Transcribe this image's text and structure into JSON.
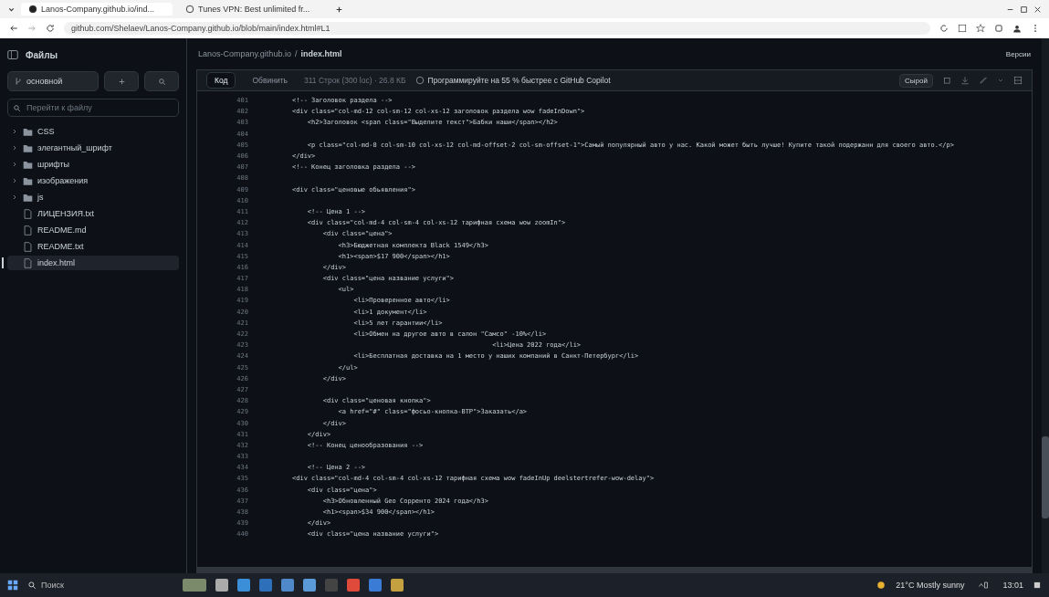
{
  "browser": {
    "tabs": [
      {
        "title": "Lanos-Company.github.io/ind...",
        "selected": true
      },
      {
        "title": "Tunes VPN: Best unlimited fr...",
        "selected": false
      }
    ],
    "address": "github.com/Shelaev/Lanos-Company.github.io/blob/main/index.html#L1"
  },
  "sidebar": {
    "title": "Файлы",
    "branch": "основной",
    "search": {
      "placeholder": "Перейти к файлу"
    },
    "items": [
      {
        "kind": "folder",
        "name": "CSS",
        "selected": false
      },
      {
        "kind": "folder",
        "name": "элегантный_шрифт",
        "selected": false
      },
      {
        "kind": "folder",
        "name": "шрифты",
        "selected": false
      },
      {
        "kind": "folder",
        "name": "изображения",
        "selected": false
      },
      {
        "kind": "folder",
        "name": "js",
        "selected": false
      },
      {
        "kind": "file",
        "name": "ЛИЦЕНЗИЯ.txt",
        "selected": false
      },
      {
        "kind": "file",
        "name": "README.md",
        "selected": false
      },
      {
        "kind": "file",
        "name": "README.txt",
        "selected": false
      },
      {
        "kind": "file",
        "name": "index.html",
        "selected": true
      }
    ]
  },
  "file": {
    "repo": "Lanos-Company.github.io",
    "separator": "/",
    "name": "index.html",
    "history": "Версии",
    "tabs": [
      {
        "label": "Код",
        "selected": true
      },
      {
        "label": "Обвинить",
        "selected": false
      }
    ],
    "info": "311 Строк (300 loc) · 26.8 КБ",
    "copilot": "Программируйте на 55 % быстрее с GitHub Copilot",
    "raw": "Сырой"
  },
  "code": [
    {
      "n": "401",
      "text": "<!-- Заголовок раздела -->"
    },
    {
      "n": "402",
      "text": "<div class=\"col-md-12 col-sm-12 col-xs-12 заголовок раздела wow fadeInDown\">"
    },
    {
      "n": "403",
      "text": "    <h2>Заголовок <span class=\"Выделите текст\">Бабки наши</span></h2>"
    },
    {
      "n": "404"
    },
    {
      "n": "405",
      "text": "    <p class=\"col-md-8 col-sm-10 col-xs-12 col-md-offset-2 col-sm-offset-1\">Самый популярный авто у нас. Какой может быть лучше! Купите такой подержанн для своего авто.</p>"
    },
    {
      "n": "406",
      "text": "</div>"
    },
    {
      "n": "407",
      "text": "<!-- Конец заголовка раздела -->"
    },
    {
      "n": "408"
    },
    {
      "n": "409",
      "text": "<div class=\"ценовые обьявления\">"
    },
    {
      "n": "410"
    },
    {
      "n": "411",
      "text": "    <!-- Цена 1 -->"
    },
    {
      "n": "412",
      "text": "    <div class=\"col-md-4 col-sm-4 col-xs-12 тарифная схема wow zoomIn\">"
    },
    {
      "n": "413",
      "text": "        <div class=\"цена\">"
    },
    {
      "n": "414",
      "text": "            <h3>Бюджетная комплекта Black 1549</h3>"
    },
    {
      "n": "415",
      "text": "            <h1><span>$17 900</span></h1>"
    },
    {
      "n": "416",
      "text": "        </div>"
    },
    {
      "n": "417",
      "text": "        <div class=\"цена название услуги\">"
    },
    {
      "n": "418",
      "text": "            <ul>"
    },
    {
      "n": "419",
      "text": "                <li>Проверенное авто</li>"
    },
    {
      "n": "420",
      "text": "                <li>1 документ</li>"
    },
    {
      "n": "421",
      "text": "                <li>5 лет гарантии</li>"
    },
    {
      "n": "422",
      "text": "                <li>Обмен на другое авто в салон \"Самсо\" -10%</li>"
    },
    {
      "n": "423",
      "text": "                                                    <li>Цена 2022 года</li>"
    },
    {
      "n": "424",
      "text": "                <li>Бесплатная доставка на 1 место у наших компаний в Санкт-Петербург</li>"
    },
    {
      "n": "425",
      "text": "            </ul>"
    },
    {
      "n": "426",
      "text": "        </div>"
    },
    {
      "n": "427"
    },
    {
      "n": "428",
      "text": "        <div class=\"ценовая кнопка\">"
    },
    {
      "n": "429",
      "text": "            <a href=\"#\" class=\"фосьо-кнопка-BTP\">Заказать</a>"
    },
    {
      "n": "430",
      "text": "        </div>"
    },
    {
      "n": "431",
      "text": "    </div>"
    },
    {
      "n": "432",
      "text": "    <!-- Конец ценообразования -->"
    },
    {
      "n": "433"
    },
    {
      "n": "434",
      "text": "    <!-- Цена 2 -->"
    },
    {
      "n": "435",
      "text": "<div class=\"col-md-4 col-sm-4 col-xs-12 тарифная схема wow fadeInUp deelstertrefer-wow-delay\">"
    },
    {
      "n": "436",
      "text": "    <div class=\"цена\">"
    },
    {
      "n": "437",
      "text": "        <h3>Обновленный Geo Сорренто 2024 года</h3>"
    },
    {
      "n": "438",
      "text": "        <h1><span>$34 900</span></h1>"
    },
    {
      "n": "439",
      "text": "    </div>"
    },
    {
      "n": "440",
      "text": "    <div class=\"цена название услуги\">"
    }
  ],
  "taskbar": {
    "search": "Поиск",
    "weather": "21°C Mostly sunny",
    "time": "13:01"
  }
}
